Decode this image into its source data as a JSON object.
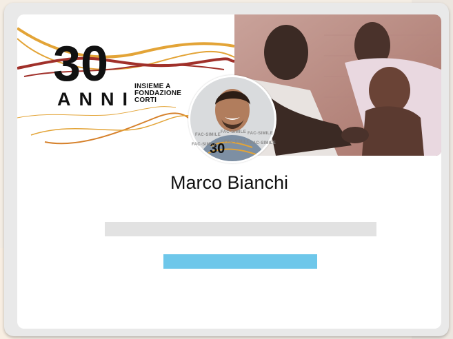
{
  "logo": {
    "number": "30",
    "anni": "ANNI",
    "subtitle_lines": [
      "INSIEME A",
      "FONDAZIONE",
      "CORTI"
    ]
  },
  "profile": {
    "name": "Marco Bianchi"
  },
  "watermark": {
    "text": "FAC-SIMILE"
  },
  "colors": {
    "accent_orange": "#e3a437",
    "accent_red": "#a0302a",
    "button_blue": "#6ec7ea",
    "skeleton_gray": "#e2e2e2"
  }
}
